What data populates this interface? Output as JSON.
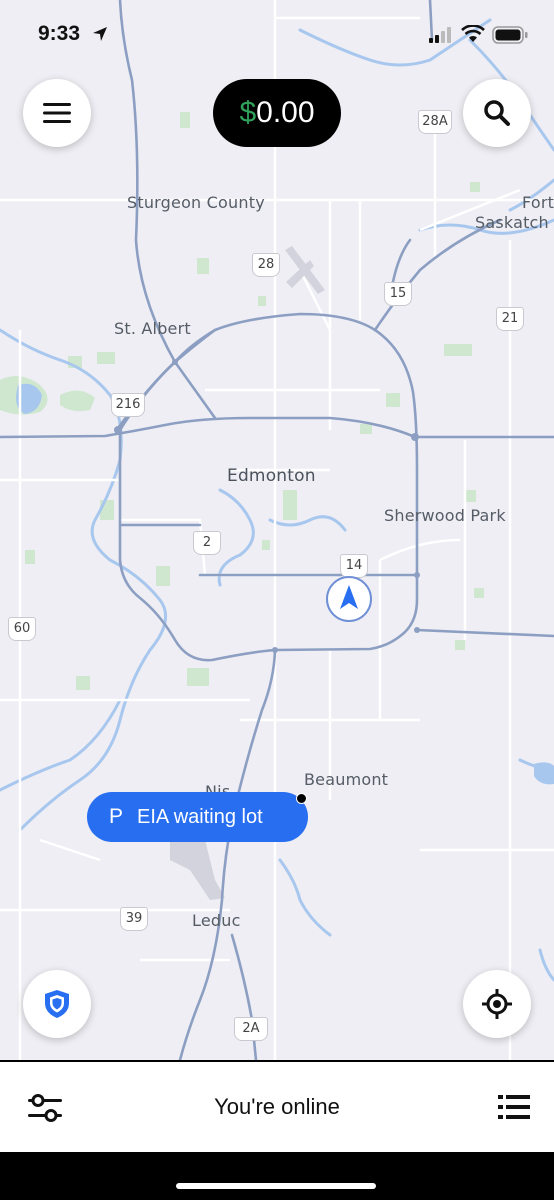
{
  "status_bar": {
    "time": "9:33"
  },
  "earnings": {
    "currency": "$",
    "amount": "0.00"
  },
  "map": {
    "places": {
      "sturgeon_county": "Sturgeon County",
      "fort_sask_1": "Fort",
      "fort_sask_2": "Saskatch",
      "st_albert": "St. Albert",
      "edmonton": "Edmonton",
      "sherwood_park": "Sherwood Park",
      "beaumont": "Beaumont",
      "nisku": "Nis",
      "leduc": "Leduc"
    },
    "highways": {
      "h28a": "28A",
      "h28": "28",
      "h15": "15",
      "h21": "21",
      "h216": "216",
      "h2": "2",
      "h14": "14",
      "h60": "60",
      "h39": "39",
      "h2a": "2A"
    }
  },
  "waiting_lot": {
    "icon_letter": "P",
    "label": "EIA waiting lot"
  },
  "bottom_bar": {
    "status_text": "You're online"
  },
  "colors": {
    "accent": "#276ef1",
    "earnings_currency": "#2fa15a",
    "map_bg": "#eeeef4"
  }
}
